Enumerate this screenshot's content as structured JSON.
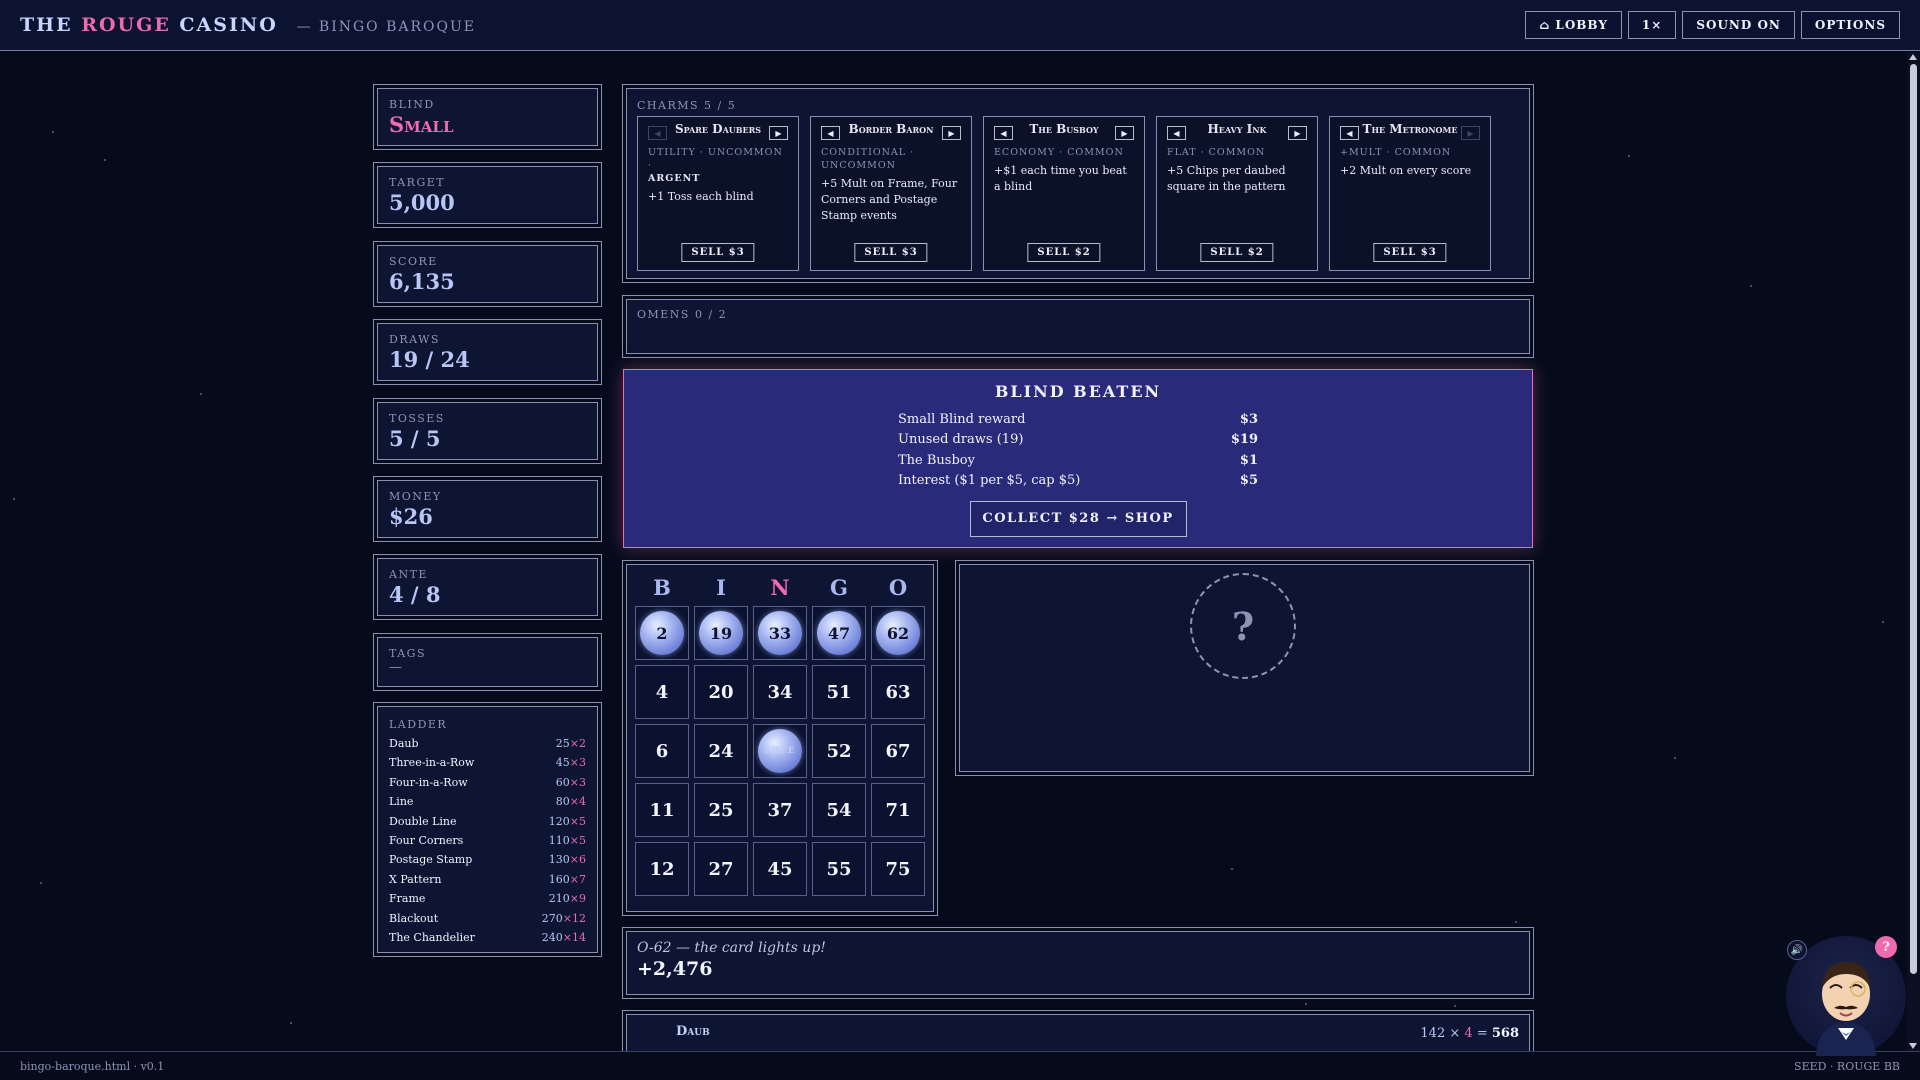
{
  "topbar": {
    "title_a": "THE ",
    "title_b": "ROUGE",
    "title_c": " CASINO",
    "subtitle": "— BINGO BAROQUE",
    "buttons": [
      "⌂ LOBBY",
      "1×",
      "SOUND ON",
      "OPTIONS"
    ]
  },
  "stats": {
    "blind_label": "Blind",
    "blind_value": "Small",
    "target_label": "Target",
    "target_value": "5,000",
    "score_label": "Score",
    "score_value": "6,135",
    "draws_label": "Draws",
    "draws_value": "19 / 24",
    "tosses_label": "Tosses",
    "tosses_value": "5 / 5",
    "money_label": "Money",
    "money_value": "$26",
    "ante_label": "Ante",
    "ante_value": "4 / 8",
    "tags_label": "Tags",
    "tags_value": "—"
  },
  "ladder": {
    "label": "Ladder",
    "rows": [
      {
        "name": "Daub",
        "chips": "25",
        "mult": "×2"
      },
      {
        "name": "Three-in-a-Row",
        "chips": "45",
        "mult": "×3"
      },
      {
        "name": "Four-in-a-Row",
        "chips": "60",
        "mult": "×3"
      },
      {
        "name": "Line",
        "chips": "80",
        "mult": "×4"
      },
      {
        "name": "Double Line",
        "chips": "120",
        "mult": "×5"
      },
      {
        "name": "Four Corners",
        "chips": "110",
        "mult": "×5"
      },
      {
        "name": "Postage Stamp",
        "chips": "130",
        "mult": "×6"
      },
      {
        "name": "X Pattern",
        "chips": "160",
        "mult": "×7"
      },
      {
        "name": "Frame",
        "chips": "210",
        "mult": "×9"
      },
      {
        "name": "Blackout",
        "chips": "270",
        "mult": "×12"
      },
      {
        "name": "The Chandelier",
        "chips": "240",
        "mult": "×14"
      }
    ]
  },
  "charms": {
    "label": "Charms 5 / 5",
    "items": [
      {
        "name": "Spare Daubers",
        "meta": "Utility · Uncommon ·",
        "edition": "ARGENT",
        "desc": "+1 Toss each blind",
        "sell": "SELL $3"
      },
      {
        "name": "Border Baron",
        "meta": "Conditional · Uncommon",
        "edition": "",
        "desc": "+5 Mult on Frame, Four Corners and Postage Stamp events",
        "sell": "SELL $3"
      },
      {
        "name": "The Busboy",
        "meta": "Economy · Common",
        "edition": "",
        "desc": "+$1 each time you beat a blind",
        "sell": "SELL $2"
      },
      {
        "name": "Heavy Ink",
        "meta": "Flat · Common",
        "edition": "",
        "desc": "+5 Chips per daubed square in the pattern",
        "sell": "SELL $2"
      },
      {
        "name": "The Metronome",
        "meta": "+Mult · Common",
        "edition": "",
        "desc": "+2 Mult on every score",
        "sell": "SELL $3"
      }
    ]
  },
  "omens": {
    "label": "Omens 0 / 2"
  },
  "blind_beaten": {
    "title": "BLIND BEATEN",
    "rows": [
      {
        "label": "Small Blind reward",
        "amount": "$3"
      },
      {
        "label": "Unused draws (19)",
        "amount": "$19"
      },
      {
        "label": "The Busboy",
        "amount": "$1"
      },
      {
        "label": "Interest ($1 per $5, cap $5)",
        "amount": "$5"
      }
    ],
    "collect_label": "COLLECT $28 → SHOP"
  },
  "card": {
    "letters": [
      "B",
      "I",
      "N",
      "G",
      "O"
    ],
    "cells": [
      {
        "v": "2",
        "d": true
      },
      {
        "v": "19",
        "d": true
      },
      {
        "v": "33",
        "d": true
      },
      {
        "v": "47",
        "d": true
      },
      {
        "v": "62",
        "d": true
      },
      {
        "v": "4",
        "d": false
      },
      {
        "v": "20",
        "d": false
      },
      {
        "v": "34",
        "d": false
      },
      {
        "v": "51",
        "d": false
      },
      {
        "v": "63",
        "d": false
      },
      {
        "v": "6",
        "d": false
      },
      {
        "v": "24",
        "d": false
      },
      {
        "v": "FREE",
        "d": true
      },
      {
        "v": "52",
        "d": false
      },
      {
        "v": "67",
        "d": false
      },
      {
        "v": "11",
        "d": false
      },
      {
        "v": "25",
        "d": false
      },
      {
        "v": "37",
        "d": false
      },
      {
        "v": "54",
        "d": false
      },
      {
        "v": "71",
        "d": false
      },
      {
        "v": "12",
        "d": false
      },
      {
        "v": "27",
        "d": false
      },
      {
        "v": "45",
        "d": false
      },
      {
        "v": "55",
        "d": false
      },
      {
        "v": "75",
        "d": false
      }
    ]
  },
  "mystery": {
    "symbol": "?"
  },
  "log": {
    "line": "O-62 — the card lights up!",
    "score": "+2,476"
  },
  "daub_row": {
    "name": "Daub",
    "chips": "142",
    "times": " × ",
    "mult": "4",
    "eq": " = ",
    "total": "568"
  },
  "footer": {
    "left": "bingo-baroque.html · v0.1",
    "right": "SEED · ROUGE BB"
  },
  "mascot": {
    "help": "?",
    "volume": "🔊"
  },
  "colors": {
    "accent_pink": "#f06ab0",
    "chip_blue": "#b9c6f5",
    "background": "#060b1c",
    "panel": "#0d1533"
  }
}
